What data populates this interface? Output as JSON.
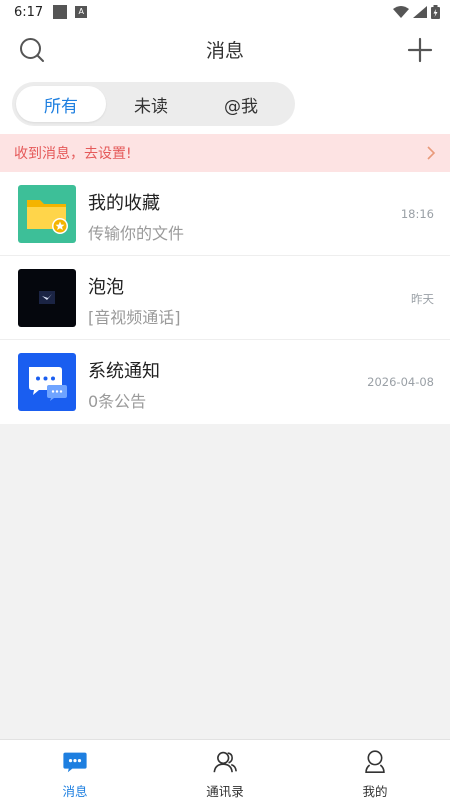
{
  "status_bar": {
    "time": "6:17",
    "badge": "A"
  },
  "header": {
    "title": "消息"
  },
  "tabs": [
    {
      "label": "所有",
      "active": true
    },
    {
      "label": "未读",
      "active": false
    },
    {
      "label": "@我",
      "active": false
    }
  ],
  "notice": {
    "text": "收到消息，去设置!"
  },
  "conversations": [
    {
      "name": "我的收藏",
      "preview": "传输你的文件",
      "time": "18:16",
      "icon": "folder-star-icon"
    },
    {
      "name": "泡泡",
      "preview": "[音视频通话]",
      "time": "昨天",
      "icon": "bubble-avatar"
    },
    {
      "name": "系统通知",
      "preview": "0条公告",
      "time": "2026-04-08",
      "icon": "chat-notice-icon"
    }
  ],
  "bottom_nav": [
    {
      "label": "消息",
      "icon": "message-icon",
      "active": true
    },
    {
      "label": "通讯录",
      "icon": "contacts-icon",
      "active": false
    },
    {
      "label": "我的",
      "icon": "profile-icon",
      "active": false
    }
  ],
  "colors": {
    "accent": "#1e7fe0",
    "notice_bg": "#fde3e3",
    "notice_text": "#e55a5a",
    "folder_bg": "#3dbf98",
    "system_bg": "#1a5ef0"
  }
}
